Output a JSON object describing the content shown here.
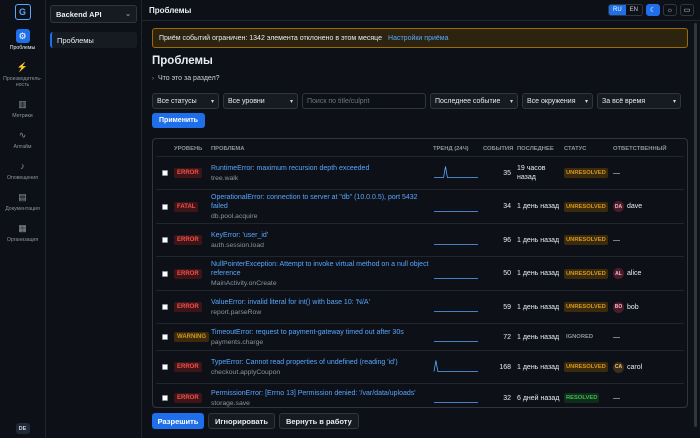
{
  "rail": {
    "logo": "G",
    "items": [
      {
        "label": "Проблемы",
        "icon": "bug-icon",
        "active": true
      },
      {
        "label": "Производитель-ность",
        "icon": "lightning-icon",
        "active": false
      },
      {
        "label": "Метрики",
        "icon": "bar-chart-icon",
        "active": false
      },
      {
        "label": "Аптайм",
        "icon": "pulse-icon",
        "active": false
      },
      {
        "label": "Оповещения",
        "icon": "bell-icon",
        "active": false
      },
      {
        "label": "Документация",
        "icon": "book-icon",
        "active": false
      },
      {
        "label": "Организация",
        "icon": "building-icon",
        "active": false
      }
    ],
    "avatar": "DE"
  },
  "sidebar": {
    "project": "Backend API",
    "link": "Проблемы"
  },
  "topbar": {
    "title": "Проблемы",
    "lang_ru": "RU",
    "lang_en": "EN"
  },
  "banner": {
    "text": "Приём событий ограничен: 1342 элемента отклонено в этом месяце",
    "link": "Настройки приёма"
  },
  "page": {
    "heading": "Проблемы",
    "what": "Что это за раздел?"
  },
  "filters": {
    "status": "Все статусы",
    "level": "Все уровни",
    "search_placeholder": "Поиск по title/culprit",
    "sort": "Последнее событие",
    "env": "Все окружения",
    "period": "За всё время",
    "apply": "Применить"
  },
  "table": {
    "headers": {
      "level": "УРОВЕНЬ",
      "problem": "ПРОБЛЕМА",
      "trend": "ТРЕНД (24Ч)",
      "events": "СОБЫТИЯ",
      "last": "ПОСЛЕДНЕЕ",
      "status": "СТАТУС",
      "owner": "ОТВЕТСТВЕННЫЙ"
    },
    "rows": [
      {
        "level": "ERROR",
        "level_class": "error",
        "title": "RuntimeError: maximum recursion depth exceeded",
        "culprit": "tree.walk",
        "events": "35",
        "last": "19 часов назад",
        "status": "UNRESOLVED",
        "status_class": "unresolved",
        "owner": "—",
        "owner_initials": "",
        "trend": [
          0,
          0,
          0,
          0,
          0,
          0,
          10,
          0,
          0,
          0,
          0,
          0,
          0,
          0,
          0,
          0,
          0,
          0,
          0,
          0,
          0,
          0,
          0,
          0
        ]
      },
      {
        "level": "FATAL",
        "level_class": "fatal",
        "title": "OperationalError: connection to server at \"db\" (10.0.0.5), port 5432 failed",
        "culprit": "db.pool.acquire",
        "events": "34",
        "last": "1 день назад",
        "status": "UNRESOLVED",
        "status_class": "unresolved",
        "owner": "dave",
        "owner_initials": "DA",
        "trend": [
          0,
          0,
          0,
          0,
          0,
          0,
          0,
          0,
          0,
          0,
          0,
          0,
          0,
          0,
          0,
          0,
          0,
          0,
          0,
          0,
          0,
          0,
          0,
          0
        ]
      },
      {
        "level": "ERROR",
        "level_class": "error",
        "title": "KeyError: 'user_id'",
        "culprit": "auth.session.load",
        "events": "96",
        "last": "1 день назад",
        "status": "UNRESOLVED",
        "status_class": "unresolved",
        "owner": "—",
        "owner_initials": "",
        "trend": [
          0,
          0,
          0,
          0,
          0,
          0,
          0,
          0,
          0,
          0,
          0,
          0,
          0,
          0,
          0,
          0,
          0,
          0,
          0,
          0,
          0,
          0,
          0,
          0
        ]
      },
      {
        "level": "ERROR",
        "level_class": "error",
        "title": "NullPointerException: Attempt to invoke virtual method on a null object reference",
        "culprit": "MainActivity.onCreate",
        "events": "50",
        "last": "1 день назад",
        "status": "UNRESOLVED",
        "status_class": "unresolved",
        "owner": "alice",
        "owner_initials": "AL",
        "trend": [
          0,
          0,
          0,
          0,
          0,
          0,
          0,
          0,
          0,
          0,
          0,
          0,
          0,
          0,
          0,
          0,
          0,
          0,
          0,
          0,
          0,
          0,
          0,
          0
        ]
      },
      {
        "level": "ERROR",
        "level_class": "error",
        "title": "ValueError: invalid literal for int() with base 10: 'N/A'",
        "culprit": "report.parseRow",
        "events": "59",
        "last": "1 день назад",
        "status": "UNRESOLVED",
        "status_class": "unresolved",
        "owner": "bob",
        "owner_initials": "BO",
        "trend": [
          0,
          0,
          0,
          0,
          0,
          0,
          0,
          0,
          0,
          0,
          0,
          0,
          0,
          0,
          0,
          0,
          0,
          0,
          0,
          0,
          0,
          0,
          0,
          0
        ]
      },
      {
        "level": "WARNING",
        "level_class": "warning",
        "title": "TimeoutError: request to payment-gateway timed out after 30s",
        "culprit": "payments.charge",
        "events": "72",
        "last": "1 день назад",
        "status": "IGNORED",
        "status_class": "ignored",
        "owner": "—",
        "owner_initials": "",
        "trend": [
          0,
          0,
          0,
          0,
          0,
          0,
          0,
          0,
          0,
          0,
          0,
          0,
          0,
          0,
          0,
          0,
          0,
          0,
          0,
          0,
          0,
          0,
          0,
          0
        ]
      },
      {
        "level": "ERROR",
        "level_class": "error",
        "title": "TypeError: Cannot read properties of undefined (reading 'id')",
        "culprit": "checkout.applyCoupon",
        "events": "168",
        "last": "1 день назад",
        "status": "UNRESOLVED",
        "status_class": "unresolved",
        "owner": "carol",
        "owner_initials": "CA",
        "trend": [
          0,
          10,
          0,
          0,
          0,
          0,
          0,
          0,
          0,
          0,
          0,
          0,
          0,
          0,
          0,
          0,
          0,
          0,
          0,
          0,
          0,
          0,
          0,
          0
        ]
      },
      {
        "level": "ERROR",
        "level_class": "error",
        "title": "PermissionError: [Errno 13] Permission denied: '/var/data/uploads'",
        "culprit": "storage.save",
        "events": "32",
        "last": "6 дней назад",
        "status": "RESOLVED",
        "status_class": "resolved",
        "owner": "—",
        "owner_initials": "",
        "trend": [
          0,
          0,
          0,
          0,
          0,
          0,
          0,
          0,
          0,
          0,
          0,
          0,
          0,
          0,
          0,
          0,
          0,
          0,
          0,
          0,
          0,
          0,
          0,
          0
        ]
      }
    ]
  },
  "actions": {
    "resolve": "Разрешить",
    "ignore": "Игнорировать",
    "reopen": "Вернуть в работу"
  },
  "colors": {
    "accent": "#1f6feb",
    "link": "#58a6ff",
    "error": "#f85149",
    "warning": "#d29922",
    "resolved": "#3fb950"
  }
}
